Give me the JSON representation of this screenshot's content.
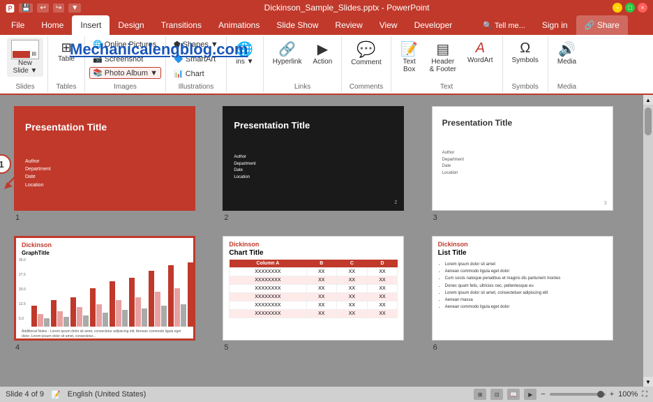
{
  "titlebar": {
    "filename": "Dickinson_Sample_Slides.pptx - PowerPoint",
    "quickaccess": [
      "save",
      "undo",
      "redo",
      "customize"
    ]
  },
  "ribbon": {
    "tabs": [
      "File",
      "Home",
      "Insert",
      "Design",
      "Transitions",
      "Animations",
      "Slide Show",
      "Review",
      "View",
      "Developer"
    ],
    "active_tab": "Insert",
    "groups": {
      "slides": {
        "label": "Slides",
        "new_slide": "New\nSlide"
      },
      "tables": {
        "label": "Tables",
        "table": "Table"
      },
      "images": {
        "label": "Images",
        "online_pictures": "Online Pictures",
        "screenshot": "Screenshot",
        "photo_album": "Photo Album"
      },
      "illustrations": {
        "label": "Illustrations",
        "shapes": "Shapes",
        "chart": "Chart"
      },
      "links": {
        "label": "Links",
        "hyperlink": "Hyperlink",
        "action": "Action"
      },
      "comments": {
        "label": "Comments",
        "comment": "Comment"
      },
      "text": {
        "label": "Text",
        "text_box": "Text\nBox",
        "header_footer": "Header\n& Footer",
        "wordart": "WordArt"
      },
      "symbols": {
        "label": "Symbols",
        "symbols": "Symbols"
      },
      "media": {
        "label": "Media",
        "media": "Media"
      }
    }
  },
  "watermark": "Mechanicalengblog.com",
  "slides": [
    {
      "num": "1",
      "type": "title_red",
      "title": "Presentation Title",
      "subtitle_lines": [
        "Author",
        "Department",
        "Date",
        "Location"
      ],
      "selected": true
    },
    {
      "num": "2",
      "type": "title_black",
      "title": "Presentation Title",
      "subtitle_lines": [
        "Author",
        "Department",
        "Date",
        "Location"
      ]
    },
    {
      "num": "3",
      "type": "title_white",
      "title": "Presentation Title",
      "subtitle_lines": [
        "Author",
        "Department",
        "Date",
        "Location"
      ]
    },
    {
      "num": "4",
      "type": "chart",
      "brand": "Dickinson",
      "title": "GraphTitle",
      "note": "Additional Notes - Lorem ipsum dolor sit amet, consectetur adipiscing elit. Aenean commodo ligula eget dolor. Lorem ipsum dolor sit amet, consectetur adipiscing elit. Aenean massa. Cum sociis natoque penatibus et magnis dis parturient montes.",
      "selected": true,
      "active": true
    },
    {
      "num": "5",
      "type": "table",
      "brand": "Dickinson",
      "title": "Chart Title",
      "columns": [
        "Column A",
        "B",
        "C",
        "D"
      ],
      "rows": [
        [
          "XXXXXXXX",
          "XX",
          "XX",
          "XX"
        ],
        [
          "XXXXXXXX",
          "XX",
          "XX",
          "XX"
        ],
        [
          "XXXXXXXX",
          "XX",
          "XX",
          "XX"
        ],
        [
          "XXXXXXXX",
          "XX",
          "XX",
          "XX"
        ],
        [
          "XXXXXXXX",
          "XX",
          "XX",
          "XX"
        ],
        [
          "XXXXXXXX",
          "XX",
          "XX",
          "XX"
        ]
      ]
    },
    {
      "num": "6",
      "type": "list",
      "brand": "Dickinson",
      "title": "List Title",
      "bullets": [
        "Lorem ipsum dolor sit amet",
        "Aenean commodo ligula eget dolor",
        "Cum sociis natoque penatibus et magnis dis parturient montes",
        "Donec quam felis, ultricies nec, pellentesque eu",
        "Lorem ipsum dolor sit amet, consectetuer adipiscing elit",
        "Aenean massa",
        "Aenean commodo ligula eget dolor"
      ]
    }
  ],
  "statusbar": {
    "slide_info": "Slide 4 of 9",
    "lang": "English (United States)",
    "zoom": "100%"
  }
}
